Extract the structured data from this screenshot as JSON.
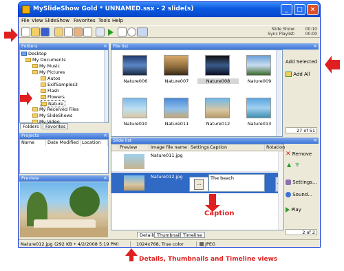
{
  "window": {
    "title": "MySlideShow Gold * UNNAMED.ssx - 2 slide(s)",
    "controls": {
      "minimize": "_",
      "maximize": "□",
      "close": "×"
    }
  },
  "menu": [
    "File",
    "View",
    "SlideShow",
    "Favorites",
    "Tools",
    "Help"
  ],
  "toolbar": {
    "slide_show_label": "Slide Show:",
    "slide_show_time": "00:10",
    "sync_playlist_label": "Sync Playlist:",
    "sync_playlist_time": "00:00"
  },
  "folders_panel": {
    "title": "Folders",
    "tree": [
      "Desktop",
      "My Documents",
      "My Music",
      "My Pictures",
      "Autos",
      "ExifSamples3",
      "Flash",
      "Flowers",
      "Nature",
      "My Received Files",
      "My SlideShows",
      "My Video"
    ],
    "selected": "Nature",
    "tabs": [
      "Folders",
      "Favorites"
    ]
  },
  "file_list": {
    "title": "File list",
    "items": [
      "Nature006",
      "Nature007",
      "Nature008",
      "Nature009",
      "Nature010",
      "Nature011",
      "Nature012",
      "Nature013"
    ],
    "selected": "Nature008",
    "add_selected": "Add Selected",
    "add_all": "Add All",
    "counter": "27 of 51"
  },
  "projects_panel": {
    "title": "Projects",
    "columns": [
      "Name",
      "Date Modified",
      "Location"
    ]
  },
  "preview_panel": {
    "title": "Preview"
  },
  "slide_list": {
    "title": "Slide list",
    "columns": [
      "Preview",
      "Image file name",
      "Settings",
      "Caption",
      "Rotation"
    ],
    "rows": [
      {
        "file": "Nature011.jpg",
        "caption": ""
      },
      {
        "file": "Nature012.jpg",
        "caption": "The beach"
      }
    ],
    "settings_button": "...",
    "tabs": [
      "Details",
      "Thumbnails",
      "Timeline"
    ],
    "buttons": {
      "remove": "Remove",
      "settings": "Settings...",
      "sound": "Sound...",
      "play": "Play"
    },
    "counter": "2 of 2"
  },
  "status_bar": {
    "file": "Nature012.jpg",
    "info": "(292 KB • 4/2/2008 5:19 PM)",
    "dimensions": "1024x768, True color",
    "format": "JPEG"
  },
  "annotations": {
    "caption": "Caption",
    "views": "Details, Thumbnails and Timeline views"
  },
  "colors": {
    "annotation_red": "#e02020",
    "title_blue": "#0a58e0",
    "selection": "#316ac5"
  }
}
